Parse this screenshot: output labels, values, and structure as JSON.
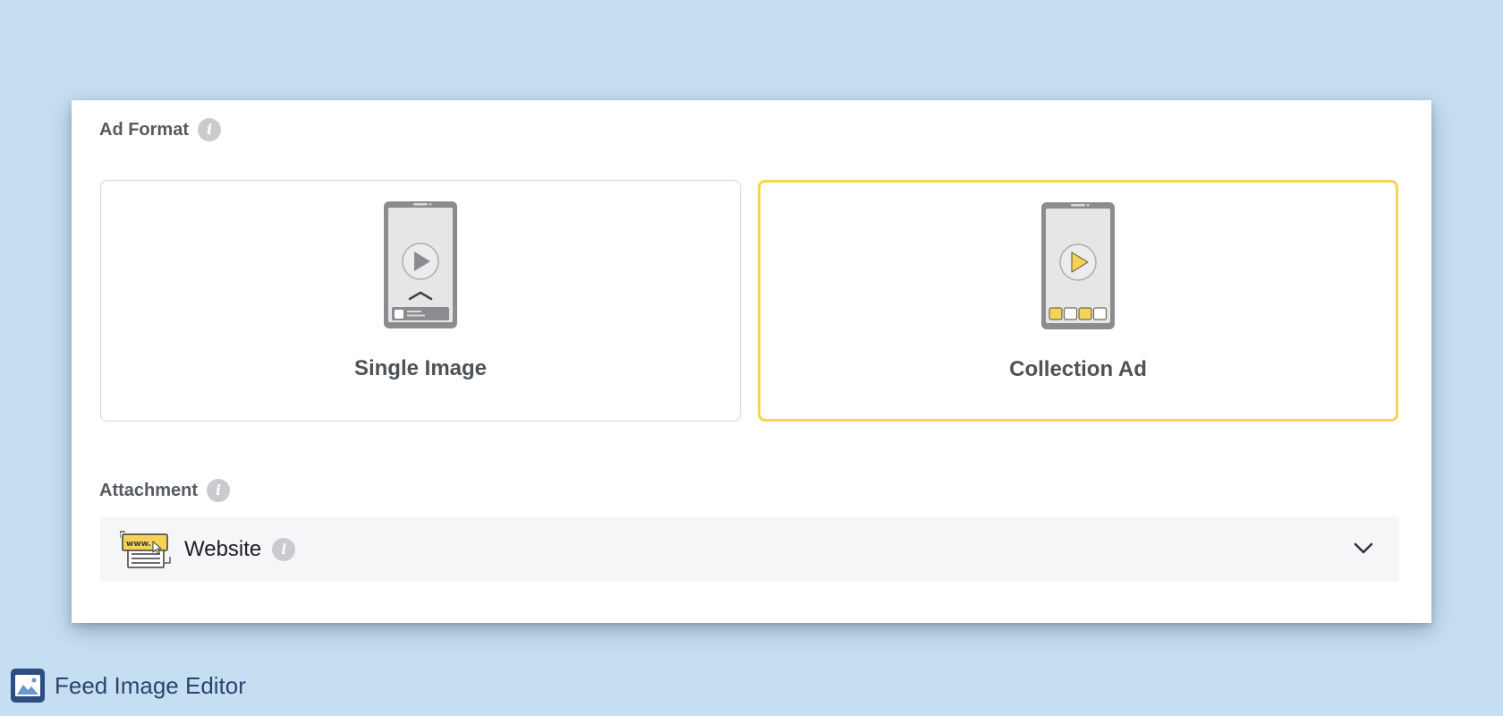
{
  "ad_format": {
    "label": "Ad Format",
    "options": [
      {
        "label": "Single Image",
        "selected": false
      },
      {
        "label": "Collection Ad",
        "selected": true
      }
    ],
    "selected_color": "#f6d356"
  },
  "attachment": {
    "label": "Attachment",
    "value": "Website",
    "icon": "website-icon",
    "icon_text": "www."
  },
  "taskbar": {
    "app_title": "Feed Image Editor",
    "icon": "image-editor-icon"
  },
  "icons": {
    "info": "i"
  },
  "colors": {
    "background": "#c6def1",
    "accent": "#f6d356",
    "info_icon": "#c9cbcf"
  }
}
